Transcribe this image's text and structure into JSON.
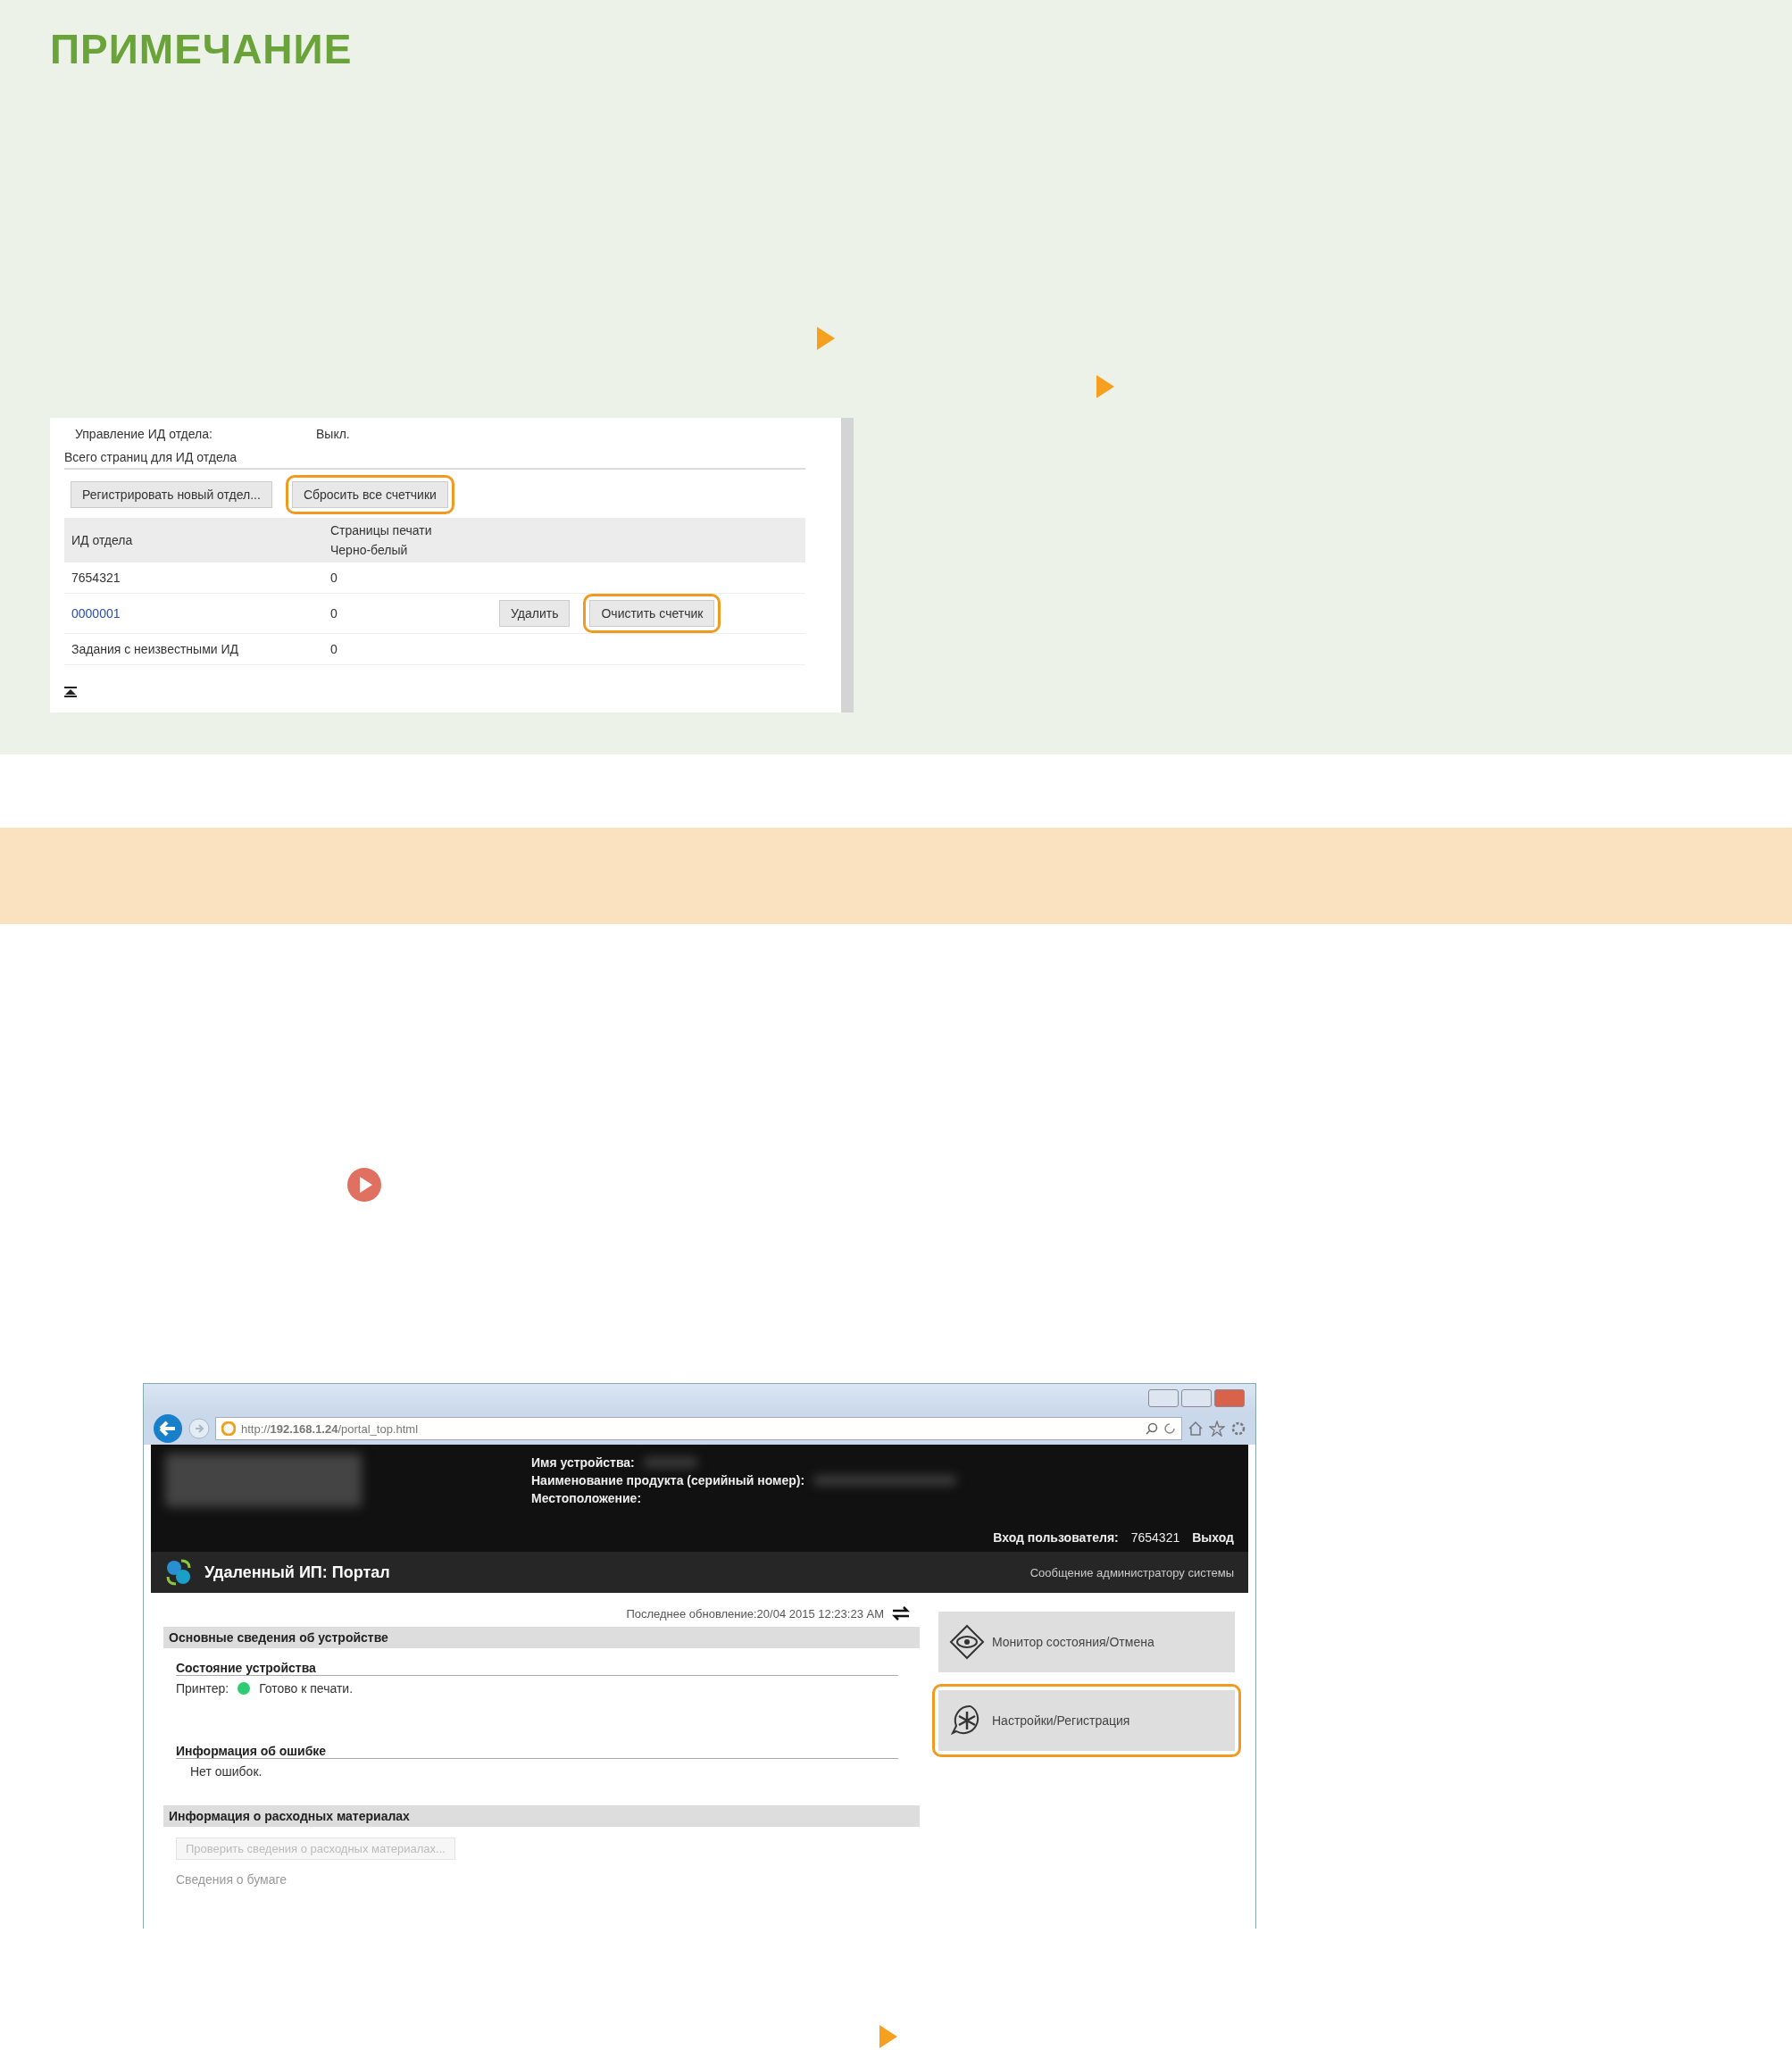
{
  "note": {
    "title": "ПРИМЕЧАНИЕ"
  },
  "dept_screen": {
    "setting": {
      "label": "Управление ИД отдела:",
      "value": "Выкл."
    },
    "section_title": "Всего страниц для ИД отдела",
    "buttons": [
      {
        "label": "Регистрировать новый отдел...",
        "highlighted": false
      },
      {
        "label": "Сбросить все счетчики",
        "highlighted": true
      }
    ],
    "columns": [
      "ИД отдела",
      "Страницы печати",
      "Черно-белый"
    ],
    "rows": [
      {
        "kind": "text",
        "id": "7654321",
        "count": "0",
        "buttons": []
      },
      {
        "kind": "link",
        "id": "0000001",
        "count": "0",
        "buttons": [
          {
            "label": "Удалить",
            "highlighted": false
          },
          {
            "label": "Очистить счетчик",
            "highlighted": true
          }
        ]
      },
      {
        "kind": "text",
        "id": "Задания с неизвестными ИД",
        "count": "0",
        "buttons": []
      }
    ]
  },
  "browser": {
    "url": "http://**192.168.1.24**/portal_top.html",
    "header_fields": [
      "Имя устройства:",
      "Наименование продукта (серийный номер):",
      "Местоположение:"
    ],
    "login_label": "Вход пользователя:",
    "login_user": "7654321",
    "logout": "Выход",
    "portal_title": "Удаленный ИП: Портал",
    "admin_link": "Сообщение администратору системы",
    "last_update": "Последнее обновление:20/04 2015 12:23:23 AM",
    "basic_title": "Основные сведения об устройстве",
    "status_title": "Состояние устройства",
    "printer_label": "Принтер:",
    "printer_status": "Готово к печати.",
    "error_title": "Информация об ошибке",
    "error_text": "Нет ошибок.",
    "supplies_title": "Информация о расходных материалах",
    "supplies_button": "Проверить сведения о расходных материалах...",
    "paper_title": "Сведения о бумаге",
    "side_buttons": [
      {
        "kind": "monitor",
        "label": "Монитор состояния/Отмена",
        "highlighted": false
      },
      {
        "kind": "settings",
        "label": "Настройки/Регистрация",
        "highlighted": true
      }
    ]
  }
}
